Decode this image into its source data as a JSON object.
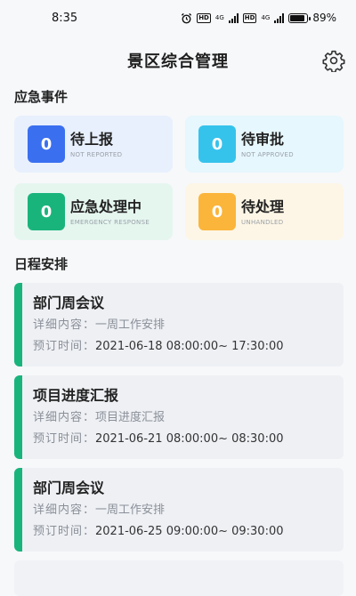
{
  "status": {
    "time": "8:35",
    "hd1": "HD",
    "net1": "4G",
    "hd2": "HD",
    "net2": "4G",
    "battery": "89%"
  },
  "header": {
    "title": "景区综合管理"
  },
  "emergency": {
    "title": "应急事件",
    "cards": [
      {
        "count": "0",
        "label": "待上报",
        "sub": "NOT REPORTED",
        "badge_color": "#3a6ff0",
        "bg": "#e8f0fd"
      },
      {
        "count": "0",
        "label": "待审批",
        "sub": "NOT APPROVED",
        "badge_color": "#35c3ec",
        "bg": "#e6f7fd"
      },
      {
        "count": "0",
        "label": "应急处理中",
        "sub": "EMERGENCY RESPONSE",
        "badge_color": "#19b47c",
        "bg": "#e5f6ef"
      },
      {
        "count": "0",
        "label": "待处理",
        "sub": "UNHANDLED",
        "badge_color": "#fbb53b",
        "bg": "#fdf6e6"
      }
    ]
  },
  "schedule": {
    "title": "日程安排",
    "detail_label": "详细内容：",
    "time_label": "预订时间：",
    "items": [
      {
        "name": "部门周会议",
        "detail": "一周工作安排",
        "time": "2021-06-18 08:00:00~ 17:30:00"
      },
      {
        "name": "项目进度汇报",
        "detail": "项目进度汇报",
        "time": "2021-06-21 08:00:00~ 08:30:00"
      },
      {
        "name": "部门周会议",
        "detail": "一周工作安排",
        "time": "2021-06-25 09:00:00~ 09:30:00"
      }
    ]
  }
}
